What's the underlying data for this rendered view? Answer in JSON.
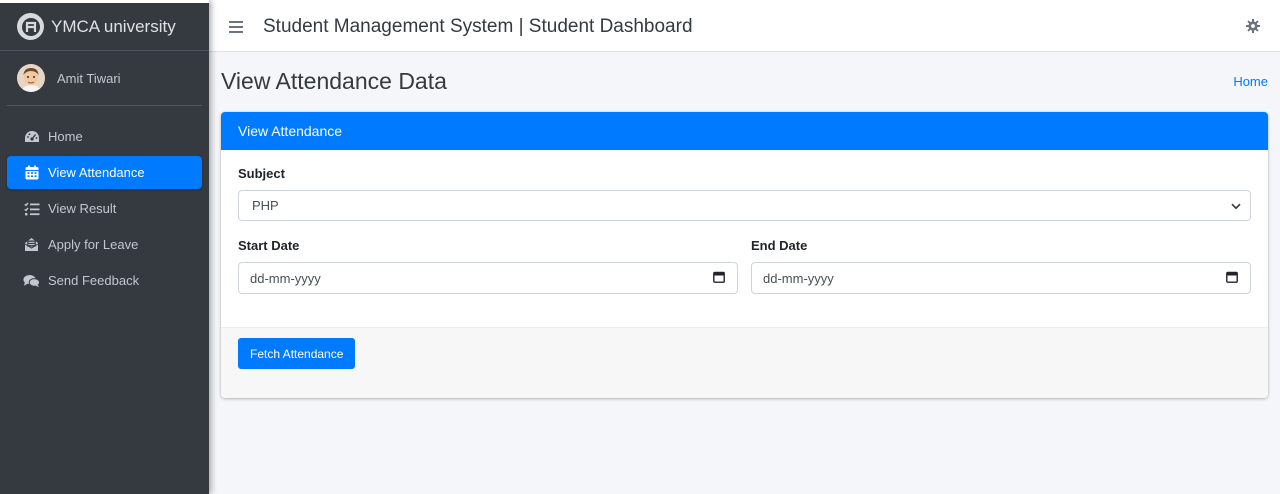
{
  "brand": {
    "name": "YMCA university",
    "logo_icon": "brand-logo-icon"
  },
  "user": {
    "name": "Amit Tiwari"
  },
  "sidebar": {
    "items": [
      {
        "label": "Home",
        "icon": "dashboard-icon",
        "active": false
      },
      {
        "label": "View Attendance",
        "icon": "calendar-icon",
        "active": true
      },
      {
        "label": "View Result",
        "icon": "list-check-icon",
        "active": false
      },
      {
        "label": "Apply for Leave",
        "icon": "envelope-open-icon",
        "active": false
      },
      {
        "label": "Send Feedback",
        "icon": "comments-icon",
        "active": false
      }
    ]
  },
  "topbar": {
    "title": "Student Management System | Student Dashboard",
    "settings_icon": "gear-icon"
  },
  "page": {
    "title": "View Attendance Data",
    "breadcrumb": "Home"
  },
  "card": {
    "header": "View Attendance",
    "subject_label": "Subject",
    "subject_value": "PHP",
    "start_label": "Start Date",
    "start_placeholder": "dd-mm-yyyy",
    "end_label": "End Date",
    "end_placeholder": "dd-mm-yyyy",
    "button": "Fetch Attendance"
  },
  "colors": {
    "accent": "#007bff",
    "sidebar": "#343a40",
    "background": "#f4f6f9"
  }
}
